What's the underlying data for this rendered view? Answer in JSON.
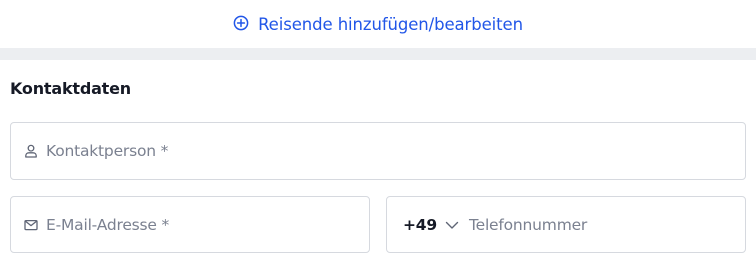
{
  "travelers": {
    "action_label": "Reisende hinzufügen/bearbeiten",
    "action_icon": "plus-circle-icon"
  },
  "contact": {
    "title": "Kontaktdaten",
    "contact_person": {
      "icon": "person-icon",
      "placeholder": "Kontaktperson *",
      "value": ""
    },
    "email": {
      "icon": "mail-icon",
      "placeholder": "E-Mail-Adresse *",
      "value": ""
    },
    "phone": {
      "country_code": "+49",
      "dropdown_icon": "chevron-down-icon",
      "placeholder": "Telefonnummer",
      "value": ""
    }
  },
  "colors": {
    "accent": "#2156e8",
    "border": "#d6d9df",
    "placeholder": "#7b8190",
    "divider": "#eceef1",
    "text": "#161a26"
  }
}
